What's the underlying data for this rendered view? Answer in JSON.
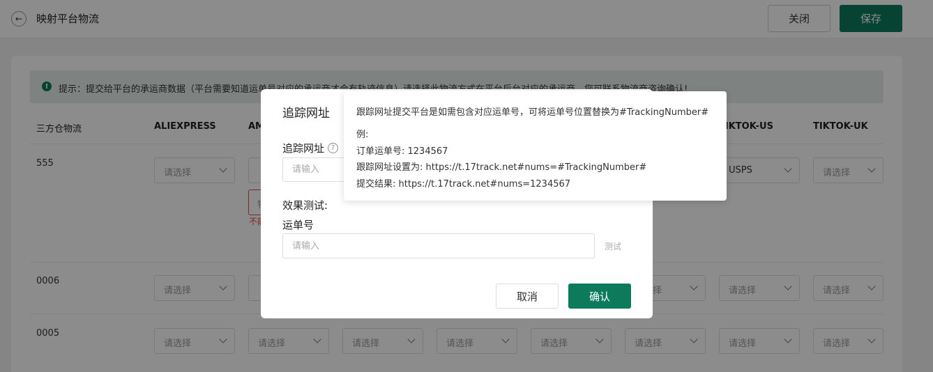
{
  "header": {
    "title": "映射平台物流",
    "close_label": "关闭",
    "save_label": "保存"
  },
  "notice": {
    "text": "提示：提交给平台的承运商数据（平台需要知道运单号对应的承运商才会有轨迹信息）请选择此物流方式在平台后台对应的承运商，您可联系物流商咨询确认!"
  },
  "table": {
    "headers": [
      "三方仓物流",
      "ALIEXPRESS",
      "AM",
      "TIKTOK-US",
      "TIKTOK-UK"
    ],
    "select_placeholder": "请选择",
    "rows": [
      {
        "label": "555",
        "tiktok_us_value": "USPS"
      },
      {
        "label": "0006"
      },
      {
        "label": "0005"
      }
    ],
    "error_hint": "不能",
    "partial_input_text": "物"
  },
  "modal": {
    "title": "追踪网址",
    "field_label": "追踪网址",
    "field_placeholder": "请输入",
    "effect_label": "效果测试:",
    "waybill_label": "运单号",
    "waybill_placeholder": "请输入",
    "test_label": "测试",
    "cancel_label": "取消",
    "ok_label": "确认"
  },
  "tooltip": {
    "line1": "跟踪网址提交平台是如需包含对应运单号，可将运单号位置替换为#TrackingNumber#",
    "line2": "例:",
    "line3": "订单运单号: 1234567",
    "line4": "跟踪网址设置为: https://t.17track.net#nums=#TrackingNumber#",
    "line5": "提交结果: https://t.17track.net#nums=1234567"
  },
  "colors": {
    "primary": "#0e7a5c",
    "notice_bg": "#e5efeb",
    "error": "#e04a4a"
  }
}
